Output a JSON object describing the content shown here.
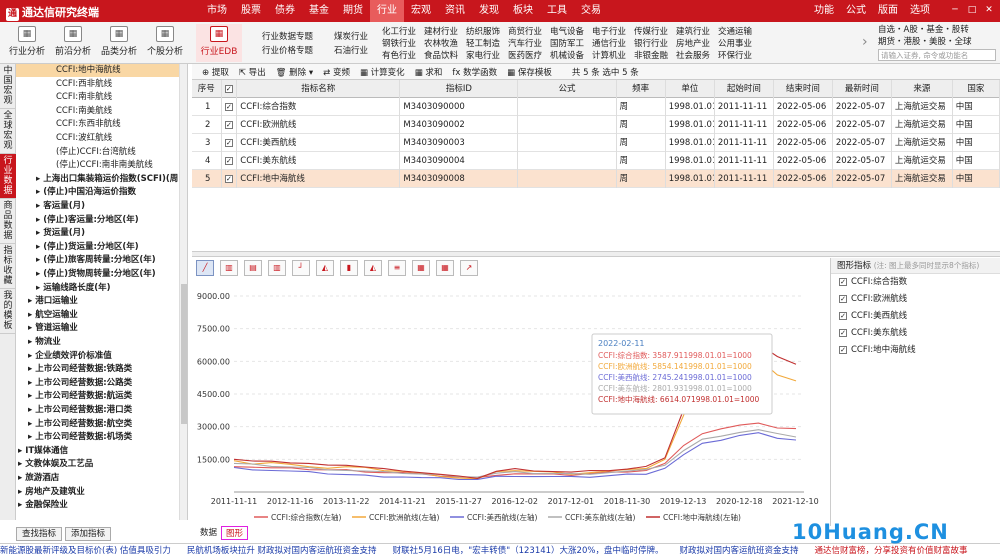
{
  "app": {
    "title": "通达信研究终端",
    "menu": [
      "市场",
      "股票",
      "债券",
      "基金",
      "期货",
      "行业",
      "宏观",
      "资讯",
      "发现",
      "板块",
      "工具",
      "交易"
    ],
    "menu_active": 5,
    "right_menu": [
      "功能",
      "公式",
      "版面",
      "选项"
    ]
  },
  "toolbar": {
    "buttons": [
      {
        "label": "行业分析",
        "icon": "grid-icon"
      },
      {
        "label": "前沿分析",
        "icon": "compass-icon"
      },
      {
        "label": "品类分析",
        "icon": "box-icon"
      },
      {
        "label": "个股分析",
        "icon": "person-icon"
      },
      {
        "label": "行业EDB",
        "icon": "database-icon"
      }
    ],
    "group1": [
      "行业数据专题",
      "行业价格专题"
    ],
    "group2": [
      "煤炭行业",
      "石油行业"
    ],
    "columns": [
      [
        "化工行业",
        "钢铁行业",
        "有色行业"
      ],
      [
        "建材行业",
        "农林牧渔",
        "食品饮料"
      ],
      [
        "纺织服饰",
        "轻工制造",
        "家电行业"
      ],
      [
        "商贸行业",
        "汽车行业",
        "医药医疗"
      ],
      [
        "电气设备",
        "国防军工",
        "机械设备"
      ],
      [
        "电子行业",
        "通信行业",
        "计算机业"
      ],
      [
        "传媒行业",
        "银行行业",
        "非银金融"
      ],
      [
        "建筑行业",
        "房地产业",
        "社会服务"
      ],
      [
        "交通运输",
        "公用事业",
        "环保行业"
      ]
    ],
    "right": [
      "自选・A股・基金・股转",
      "期货・港股・美股・全球"
    ],
    "search_placeholder": "请输入证券, 命令或功能名"
  },
  "left_tabs": [
    "中国宏观",
    "全球宏观",
    "行业数据",
    "商品数据",
    "指标收藏",
    "我的模板"
  ],
  "left_tab_active": 2,
  "tree": [
    {
      "t": "CCFI:地中海航线",
      "ind": 40,
      "sel": true
    },
    {
      "t": "CCFI:西非航线",
      "ind": 40
    },
    {
      "t": "CCFI:南非航线",
      "ind": 40
    },
    {
      "t": "CCFI:南美航线",
      "ind": 40
    },
    {
      "t": "CCFI:东西非航线",
      "ind": 40
    },
    {
      "t": "CCFI:波红航线",
      "ind": 40
    },
    {
      "t": "(停止)CCFI:台湾航线",
      "ind": 40
    },
    {
      "t": "(停止)CCFI:南非南美航线",
      "ind": 40
    },
    {
      "t": "▸ 上海出口集装箱运价指数(SCFI)(周",
      "ind": 20,
      "b": true
    },
    {
      "t": "▸ (停止)中国沿海运价指数",
      "ind": 20,
      "b": true
    },
    {
      "t": "▸ 客运量(月)",
      "ind": 20,
      "b": true
    },
    {
      "t": "▸ (停止)客运量:分地区(年)",
      "ind": 20,
      "b": true
    },
    {
      "t": "▸ 货运量(月)",
      "ind": 20,
      "b": true
    },
    {
      "t": "▸ (停止)货运量:分地区(年)",
      "ind": 20,
      "b": true
    },
    {
      "t": "▸ (停止)旅客周转量:分地区(年)",
      "ind": 20,
      "b": true
    },
    {
      "t": "▸ (停止)货物周转量:分地区(年)",
      "ind": 20,
      "b": true
    },
    {
      "t": "▸ 运输线路长度(年)",
      "ind": 20,
      "b": true
    },
    {
      "t": "▸ 港口运输业",
      "ind": 12,
      "b": true
    },
    {
      "t": "▸ 航空运输业",
      "ind": 12,
      "b": true
    },
    {
      "t": "▸ 管道运输业",
      "ind": 12,
      "b": true
    },
    {
      "t": "▸ 物流业",
      "ind": 12,
      "b": true
    },
    {
      "t": "▸ 企业绩效评价标准值",
      "ind": 12,
      "b": true
    },
    {
      "t": "▸ 上市公司经营数据:铁路类",
      "ind": 12,
      "b": true
    },
    {
      "t": "▸ 上市公司经营数据:公路类",
      "ind": 12,
      "b": true
    },
    {
      "t": "▸ 上市公司经营数据:航运类",
      "ind": 12,
      "b": true
    },
    {
      "t": "▸ 上市公司经营数据:港口类",
      "ind": 12,
      "b": true
    },
    {
      "t": "▸ 上市公司经营数据:航空类",
      "ind": 12,
      "b": true
    },
    {
      "t": "▸ 上市公司经营数据:机场类",
      "ind": 12,
      "b": true
    },
    {
      "t": "▸ IT媒体通信",
      "ind": 2,
      "b": true
    },
    {
      "t": "▸ 文教体娱及工艺品",
      "ind": 2,
      "b": true
    },
    {
      "t": "▸ 旅游酒店",
      "ind": 2,
      "b": true
    },
    {
      "t": "▸ 房地产及建筑业",
      "ind": 2,
      "b": true
    },
    {
      "t": "▸ 金融保险业",
      "ind": 2,
      "b": true
    }
  ],
  "tree_buttons": [
    "查找指标",
    "添加指标"
  ],
  "ops": [
    "⊕ 提取",
    "⇱ 导出",
    "🗑 删除 ▾",
    "⇄ 变频",
    "▦ 计算变化",
    "▦ 求和",
    "fx 数学函数",
    "▦ 保存模板",
    "共 5 条 选中 5 条"
  ],
  "table": {
    "headers": [
      "序号",
      "",
      "指标名称",
      "指标ID",
      "公式",
      "频率",
      "单位",
      "起始时间",
      "结束时间",
      "最新时间",
      "来源",
      "国家"
    ],
    "rows": [
      [
        "1",
        "✓",
        "CCFI:综合指数",
        "M3403090000",
        "",
        "周",
        "1998.01.01=",
        "2011-11-11",
        "2022-05-06",
        "2022-05-07",
        "上海航运交易",
        "中国"
      ],
      [
        "2",
        "✓",
        "CCFI:欧洲航线",
        "M3403090002",
        "",
        "周",
        "1998.01.01=",
        "2011-11-11",
        "2022-05-06",
        "2022-05-07",
        "上海航运交易",
        "中国"
      ],
      [
        "3",
        "✓",
        "CCFI:美西航线",
        "M3403090003",
        "",
        "周",
        "1998.01.01=",
        "2011-11-11",
        "2022-05-06",
        "2022-05-07",
        "上海航运交易",
        "中国"
      ],
      [
        "4",
        "✓",
        "CCFI:美东航线",
        "M3403090004",
        "",
        "周",
        "1998.01.01=",
        "2011-11-11",
        "2022-05-06",
        "2022-05-07",
        "上海航运交易",
        "中国"
      ],
      [
        "5",
        "✓",
        "CCFI:地中海航线",
        "M3403090008",
        "",
        "周",
        "1998.01.01=",
        "2011-11-11",
        "2022-05-06",
        "2022-05-07",
        "上海航运交易",
        "中国"
      ]
    ],
    "selected_row": 4
  },
  "chart_icons": [
    "line-chart-icon",
    "bar-chart-icon",
    "stacked-bar-icon",
    "bar-chart-2-icon",
    "step-line-icon",
    "area-chart-icon",
    "column-chart-icon",
    "area-chart-2-icon",
    "horizontal-bar-icon",
    "table-chart-icon",
    "indicator-icon",
    "export-icon"
  ],
  "legend_panel": {
    "title": "图形指标",
    "hint": "(注: 图上最多同时显示8个指标)",
    "items": [
      "CCFI:综合指数",
      "CCFI:欧洲航线",
      "CCFI:美西航线",
      "CCFI:美东航线",
      "CCFI:地中海航线"
    ]
  },
  "bottom_tabs": [
    "数据",
    "图形"
  ],
  "ticker": [
    {
      "t": "新能源股最新评级及目标价(表) 估值具吸引力",
      "c": "blue"
    },
    {
      "t": "民航机场板块拉升 财政拟对国内客运航班资金支持",
      "c": "blue"
    },
    {
      "t": "财联社5月16日电，\"宏丰转债\"（123141）大涨20%，盘中临时停牌。",
      "c": "blue"
    },
    {
      "t": "财政拟对国内客运航班资金支持",
      "c": "blue"
    },
    {
      "t": "通达信财富榜，分享投资有价值财富故事",
      "c": "red"
    }
  ],
  "watermark": "10Huang.CN",
  "chart_data": {
    "type": "line",
    "x_ticks": [
      "2011-11-11",
      "2012-11-16",
      "2013-11-22",
      "2014-11-21",
      "2015-11-27",
      "2016-12-02",
      "2017-12-01",
      "2018-11-30",
      "2019-12-13",
      "2020-12-18",
      "2021-12-10"
    ],
    "y_ticks": [
      "9000.00",
      "7500.00",
      "6000.00",
      "4500.00",
      "3000.00",
      "1500.00"
    ],
    "ylim": [
      0,
      9000
    ],
    "series": [
      {
        "name": "CCFI:综合指数(左轴)",
        "color": "#e05a5a",
        "values": [
          1200,
          1150,
          1100,
          1080,
          1050,
          1020,
          1000,
          950,
          900,
          880,
          800,
          750,
          700,
          650,
          800,
          850,
          820,
          800,
          780,
          850,
          900,
          950,
          1000,
          1300,
          2100,
          2700,
          2900,
          3050,
          3200,
          2950,
          2900
        ]
      },
      {
        "name": "CCFI:欧洲航线(左轴)",
        "color": "#f2a93b",
        "values": [
          1400,
          1300,
          1350,
          1250,
          1200,
          1100,
          1150,
          1100,
          1000,
          950,
          850,
          750,
          650,
          600,
          900,
          1000,
          950,
          900,
          850,
          900,
          950,
          1000,
          1100,
          1500,
          3500,
          5500,
          6000,
          5800,
          6100,
          5400,
          5100
        ]
      },
      {
        "name": "CCFI:美西航线(左轴)",
        "color": "#6b6bd6",
        "values": [
          1100,
          1050,
          1000,
          950,
          900,
          850,
          800,
          750,
          720,
          700,
          650,
          620,
          600,
          580,
          700,
          750,
          720,
          700,
          680,
          700,
          750,
          800,
          850,
          1100,
          1700,
          2200,
          2400,
          2600,
          2700,
          2500,
          2400
        ]
      },
      {
        "name": "CCFI:美东航线(左轴)",
        "color": "#aaaaaa",
        "values": [
          1300,
          1250,
          1200,
          1150,
          1100,
          1050,
          1000,
          950,
          900,
          880,
          820,
          780,
          740,
          700,
          850,
          900,
          870,
          850,
          820,
          850,
          900,
          950,
          1000,
          1250,
          1900,
          2400,
          2600,
          2750,
          2850,
          2650,
          2550
        ]
      },
      {
        "name": "CCFI:地中海航线(左轴)",
        "color": "#c03030",
        "values": [
          1500,
          1400,
          1450,
          1350,
          1300,
          1200,
          1250,
          1150,
          1050,
          1000,
          900,
          800,
          700,
          650,
          950,
          1050,
          1000,
          950,
          900,
          950,
          1000,
          1050,
          1150,
          1600,
          3800,
          6000,
          6600,
          6400,
          6800,
          6200,
          5900
        ]
      }
    ],
    "tooltip": {
      "date": "2022-02-11",
      "lines": [
        "CCFI:综合指数: 3587.911998.01.01=1000",
        "CCFI:欧洲航线: 5854.141998.01.01=1000",
        "CCFI:美西航线: 2745.241998.01.01=1000",
        "CCFI:美东航线: 2801.931998.01.01=1000",
        "CCFI:地中海航线: 6614.071998.01.01=1000"
      ]
    }
  }
}
